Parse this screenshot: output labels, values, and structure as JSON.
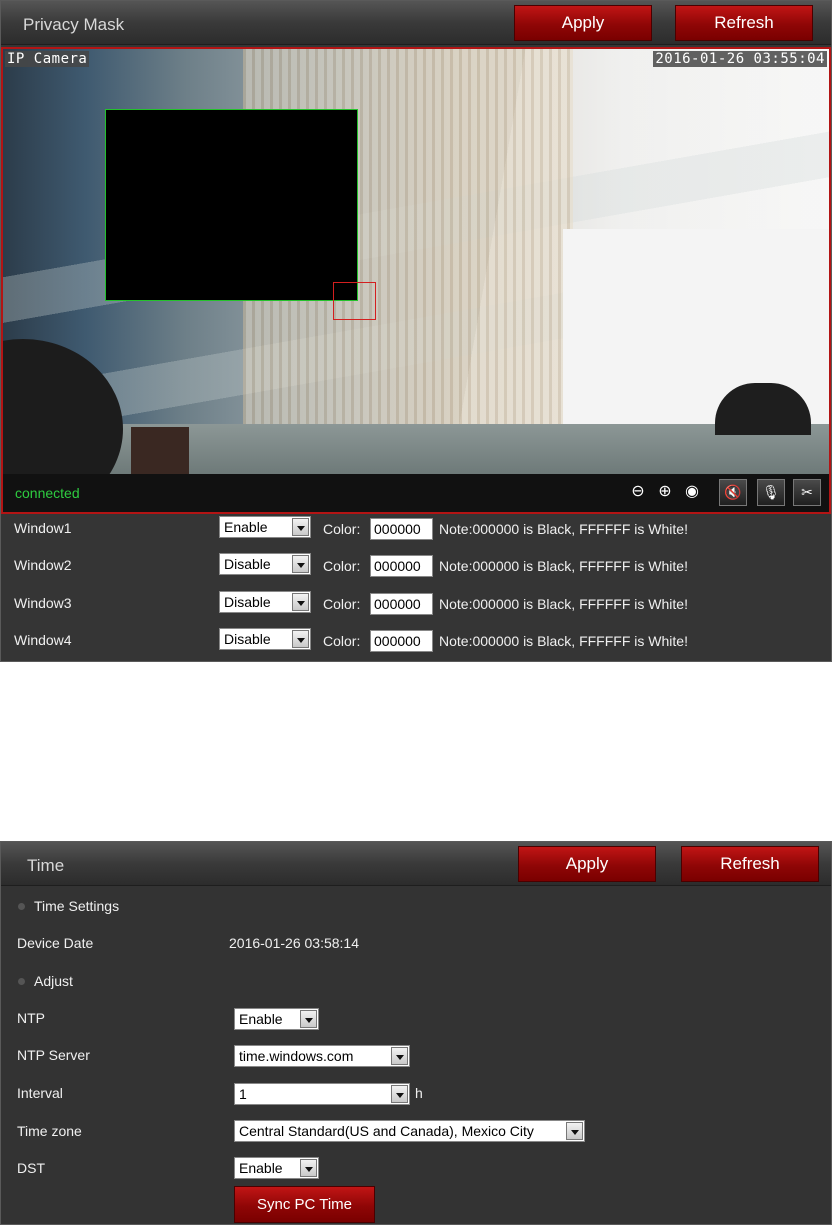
{
  "privacy_mask": {
    "title": "Privacy Mask",
    "apply_label": "Apply",
    "refresh_label": "Refresh",
    "camera": {
      "name": "IP Camera",
      "timestamp": "2016-01-26 03:55:04",
      "status": "connected"
    },
    "color_label": "Color:",
    "note": "Note:000000 is Black, FFFFFF is White!",
    "windows": [
      {
        "label": "Window1",
        "state": "Enable",
        "color": "000000"
      },
      {
        "label": "Window2",
        "state": "Disable",
        "color": "000000"
      },
      {
        "label": "Window3",
        "state": "Disable",
        "color": "000000"
      },
      {
        "label": "Window4",
        "state": "Disable",
        "color": "000000"
      }
    ]
  },
  "time": {
    "title": "Time",
    "apply_label": "Apply",
    "refresh_label": "Refresh",
    "section_settings": "Time Settings",
    "device_date_label": "Device Date",
    "device_date": "2016-01-26 03:58:14",
    "section_adjust": "Adjust",
    "ntp_label": "NTP",
    "ntp_value": "Enable",
    "ntp_server_label": "NTP Server",
    "ntp_server_value": "time.windows.com",
    "interval_label": "Interval",
    "interval_value": "1",
    "interval_unit": "h",
    "timezone_label": "Time zone",
    "timezone_value": "Central Standard(US and Canada), Mexico City",
    "dst_label": "DST",
    "dst_value": "Enable",
    "sync_label": "Sync PC Time"
  },
  "colors": {
    "accent_red": "#9b0a0a",
    "panel_bg": "#333333",
    "status_green": "#2ecc40",
    "mask_border": "#24c22c"
  }
}
